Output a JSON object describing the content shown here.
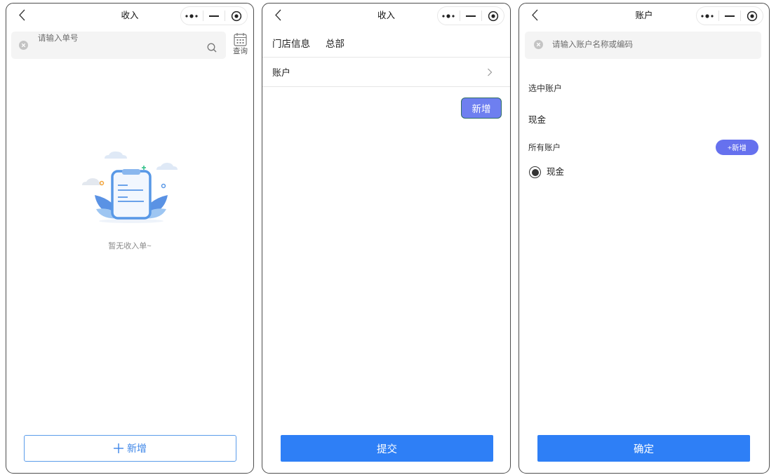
{
  "screens": [
    {
      "title": "收入",
      "search": {
        "placeholder": "请输入单号"
      },
      "calendar": {
        "label": "查询"
      },
      "empty_state": {
        "text": "暂无收入单~"
      },
      "add_button": {
        "label": "新增"
      },
      "icons": [
        "back-chevron-icon",
        "more-dots-icon",
        "minimize-icon",
        "close-target-icon",
        "clear-icon",
        "search-icon",
        "calendar-icon",
        "plus-icon"
      ]
    },
    {
      "title": "收入",
      "store_info": {
        "label": "门店信息",
        "value": "总部"
      },
      "account_row": {
        "label": "账户"
      },
      "add_button": {
        "label": "新增"
      },
      "submit_button": {
        "label": "提交"
      },
      "icons": [
        "back-chevron-icon",
        "more-dots-icon",
        "minimize-icon",
        "close-target-icon",
        "chevron-right-icon"
      ]
    },
    {
      "title": "账户",
      "search": {
        "placeholder": "请输入账户名称或编码"
      },
      "selected_section": {
        "label": "选中账户",
        "value": "现金"
      },
      "all_section": {
        "label": "所有账户",
        "add_button": "+新增"
      },
      "accounts": [
        {
          "name": "现金",
          "selected": true
        }
      ],
      "confirm_button": {
        "label": "确定"
      },
      "icons": [
        "back-chevron-icon",
        "more-dots-icon",
        "minimize-icon",
        "close-target-icon",
        "clear-icon",
        "radio-checked-icon"
      ]
    }
  ],
  "colors": {
    "primary_button": "#2e7ff6",
    "accent_button": "#6e7ff0",
    "pill_button": "#6671ee",
    "outline_button": "#5b9cea",
    "search_background": "#f4f4f4"
  }
}
